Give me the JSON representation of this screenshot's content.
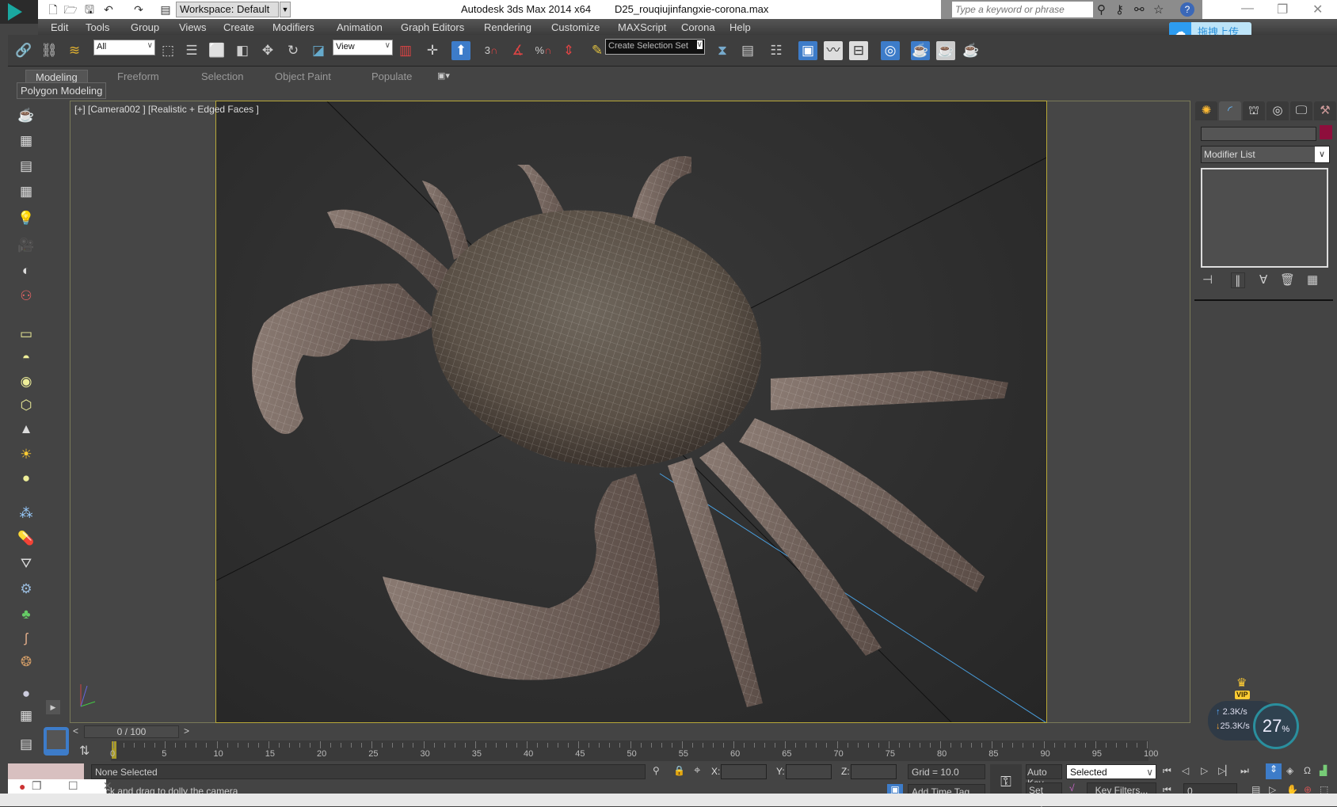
{
  "titlebar": {
    "workspace": "Workspace: Default",
    "app_title": "Autodesk 3ds Max  2014 x64",
    "file_name": "D25_rouqiujinfangxie-corona.max",
    "search_placeholder": "Type a keyword or phrase",
    "help": "?"
  },
  "menu": [
    "Edit",
    "Tools",
    "Group",
    "Views",
    "Create",
    "Modifiers",
    "Animation",
    "Graph Editors",
    "Rendering",
    "Customize",
    "MAXScript",
    "Corona",
    "Help"
  ],
  "upload_button": "拖拽上传",
  "toolbar": {
    "filter": "All",
    "ref_coord": "View",
    "snap_angle": "3",
    "snap_pct": "%",
    "selection_set": "Create Selection Set"
  },
  "ribbon": {
    "tabs": [
      "Modeling",
      "Freeform",
      "Selection",
      "Object Paint",
      "Populate"
    ],
    "panel": "Polygon Modeling"
  },
  "viewport": {
    "label": "[+] [Camera002 ] [Realistic + Edged Faces ]"
  },
  "command_panel": {
    "modifier_list": "Modifier List",
    "color": "#8e0e3c"
  },
  "timeline": {
    "slider": "0 / 100",
    "ticks": [
      "0",
      "5",
      "10",
      "15",
      "20",
      "25",
      "30",
      "35",
      "40",
      "45",
      "50",
      "55",
      "60",
      "65",
      "70",
      "75",
      "80",
      "85",
      "90",
      "95",
      "100"
    ]
  },
  "status": {
    "selection": "None Selected",
    "prompt": "Click and drag to dolly the camera",
    "x_label": "X:",
    "y_label": "Y:",
    "z_label": "Z:",
    "grid": "Grid = 10.0",
    "add_time_tag": "Add Time Tag",
    "auto_key": "Auto Key",
    "set_key": "Set Key",
    "key_mode": "Selected",
    "key_filters": "Key Filters...",
    "frame": "0"
  },
  "network": {
    "up": "2.3K/s",
    "down": "25.3K/s",
    "percent": "27",
    "percent_unit": "%",
    "badge": "VIP"
  }
}
